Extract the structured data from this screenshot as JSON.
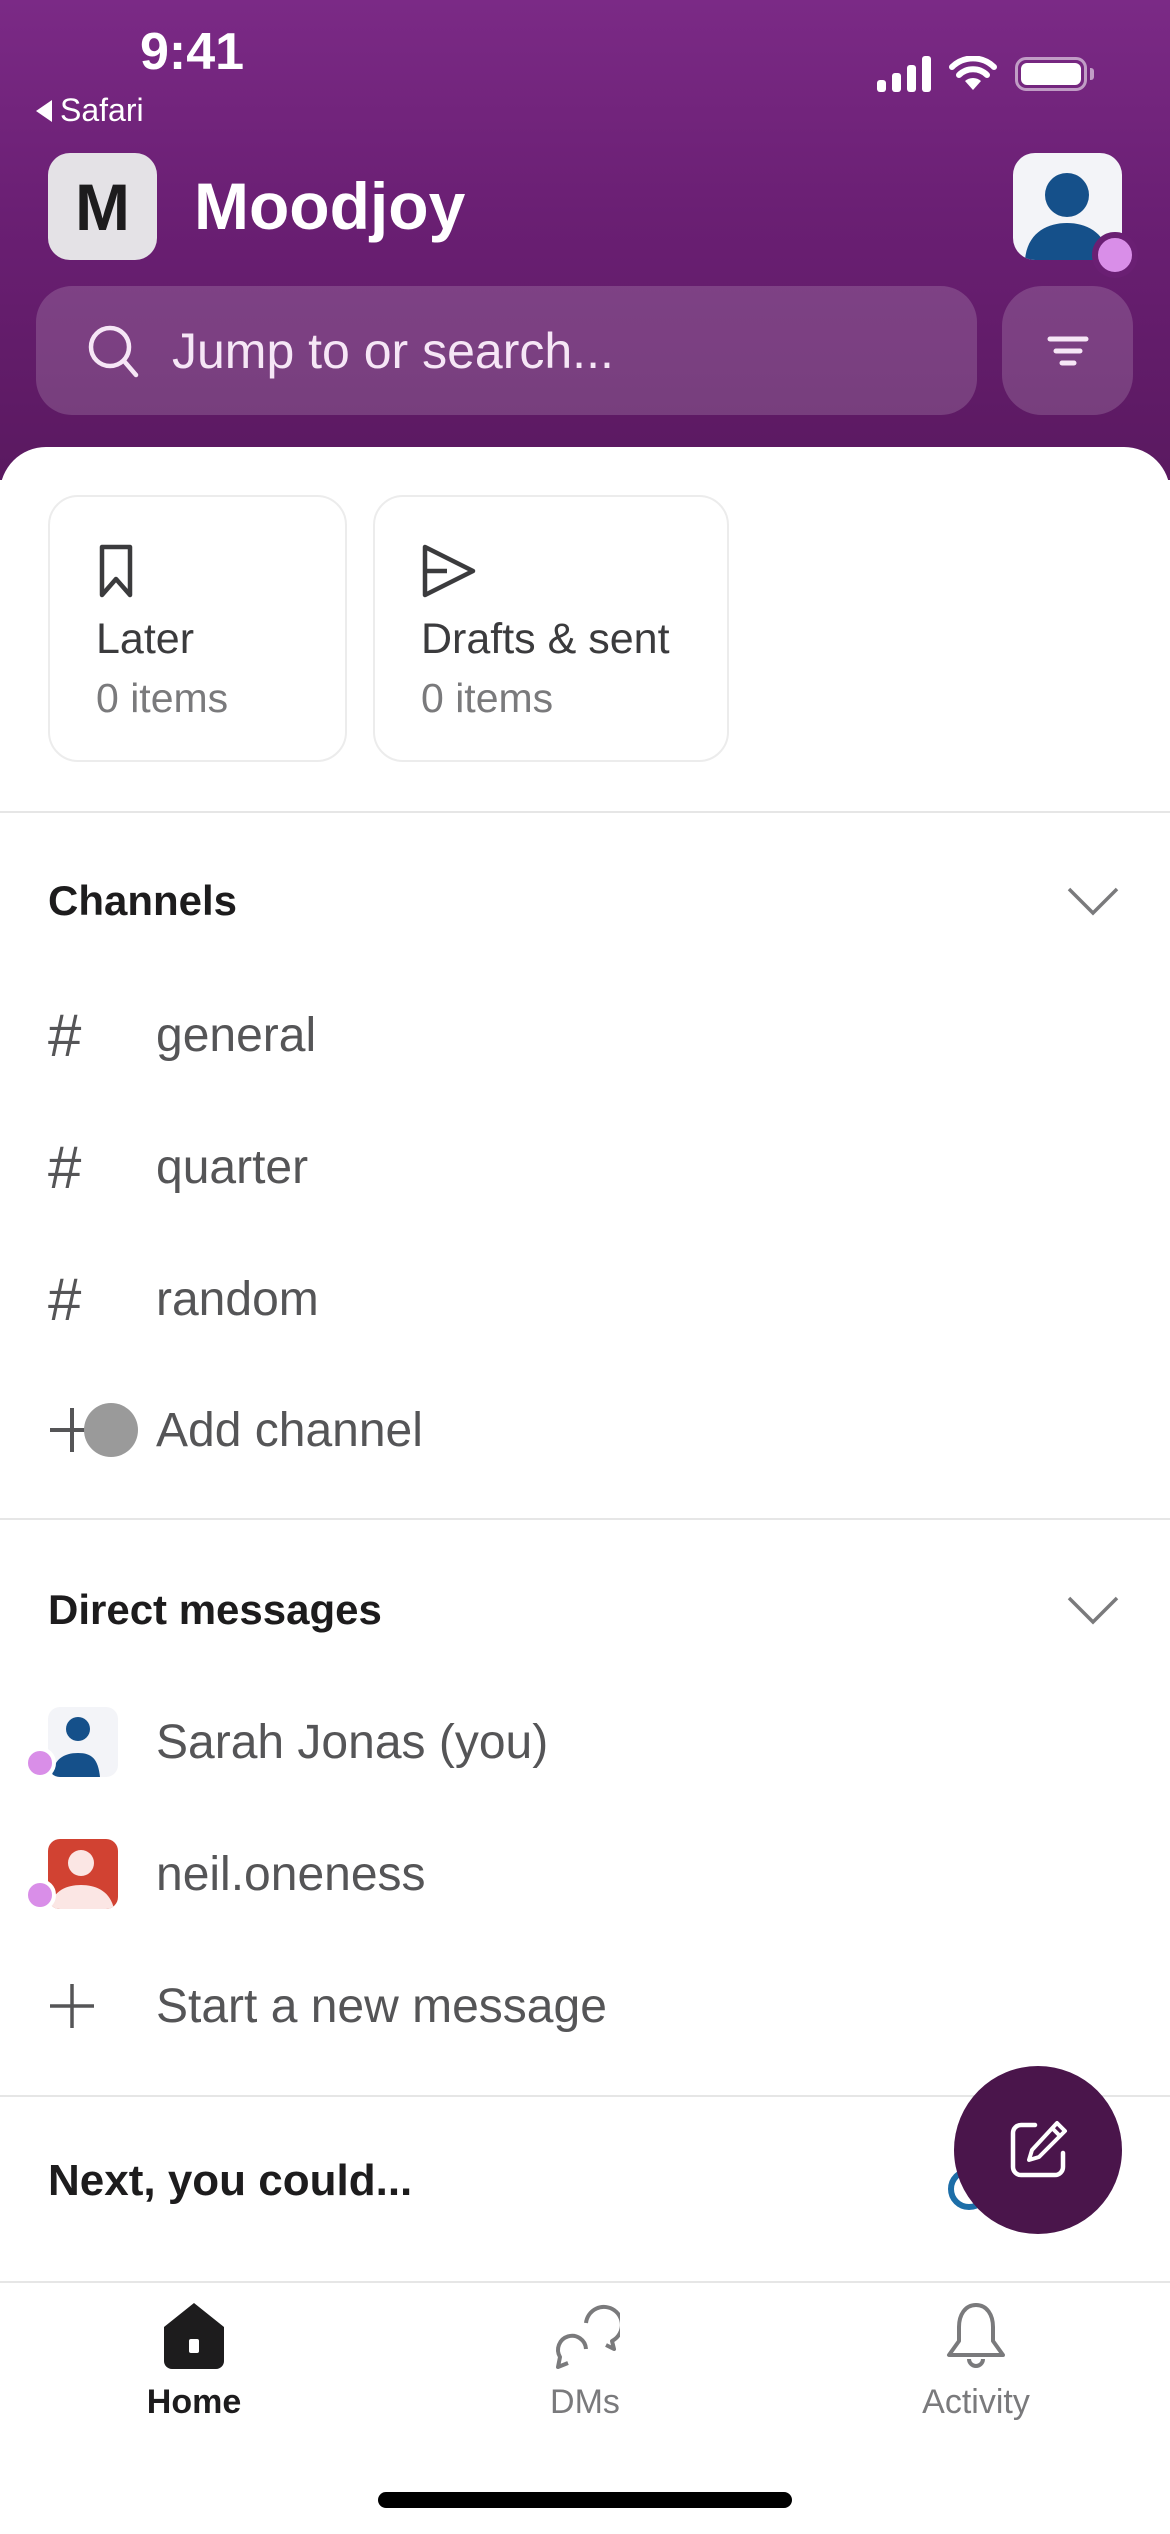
{
  "status_bar": {
    "time": "9:41",
    "back_app": "Safari",
    "icons": [
      "cellular-signal-icon",
      "wifi-icon",
      "battery-icon"
    ]
  },
  "header": {
    "workspace_initial": "M",
    "workspace_name": "Moodjoy",
    "avatar_icon": "user-avatar-icon",
    "presence": "online",
    "search_placeholder": "Jump to or search...",
    "filter_icon": "filter-icon"
  },
  "colors": {
    "header_bg": "#6a1f73",
    "fab_bg": "#4a154b",
    "presence": "#d98ee8",
    "avatar_blue": "#15508a",
    "avatar_red": "#d14232"
  },
  "quick_cards": [
    {
      "icon": "bookmark-icon",
      "title": "Later",
      "subtitle": "0 items"
    },
    {
      "icon": "send-icon",
      "title": "Drafts & sent",
      "subtitle": "0 items"
    }
  ],
  "channels": {
    "title": "Channels",
    "items": [
      {
        "icon": "hash-icon",
        "name": "general"
      },
      {
        "icon": "hash-icon",
        "name": "quarter"
      },
      {
        "icon": "hash-icon",
        "name": "random"
      }
    ],
    "add_label": "Add channel"
  },
  "direct_messages": {
    "title": "Direct messages",
    "items": [
      {
        "name": "Sarah Jonas (you)",
        "avatar_color": "blue"
      },
      {
        "name": "neil.oneness",
        "avatar_color": "red"
      }
    ],
    "new_label": "Start a new message"
  },
  "next": {
    "title": "Next, you could..."
  },
  "fab": {
    "icon": "compose-icon"
  },
  "tabs": [
    {
      "label": "Home",
      "icon": "home-icon",
      "active": true
    },
    {
      "label": "DMs",
      "icon": "dms-icon",
      "active": false
    },
    {
      "label": "Activity",
      "icon": "bell-icon",
      "active": false
    }
  ],
  "glyphs": {
    "hash": "#",
    "plus": "+"
  }
}
